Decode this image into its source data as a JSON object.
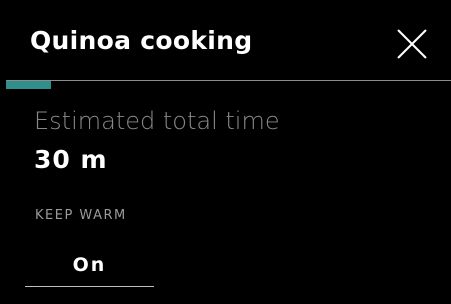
{
  "header": {
    "title": "Quinoa cooking",
    "close_icon": "close-icon"
  },
  "progress": {
    "fraction": 0.1,
    "fill_color": "#2f8f8a",
    "track_color": "#8c8c8c"
  },
  "estimate": {
    "label": "Estimated total time",
    "value": "30 m"
  },
  "keep_warm": {
    "label": "KEEP WARM",
    "value": "On"
  }
}
